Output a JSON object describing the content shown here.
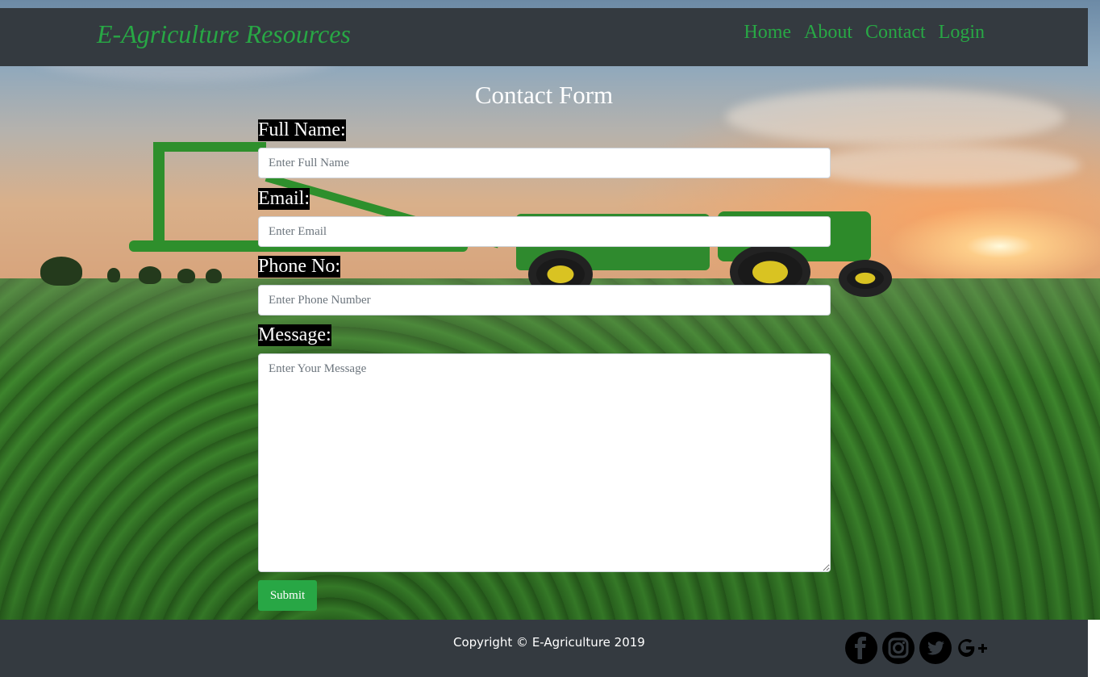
{
  "header": {
    "brand": "E-Agriculture Resources",
    "nav": [
      "Home",
      "About",
      "Contact",
      "Login"
    ]
  },
  "form": {
    "title": "Contact Form",
    "full_name_label": "Full Name:",
    "full_name_placeholder": "Enter Full Name",
    "email_label": "Email:",
    "email_placeholder": "Enter Email",
    "phone_label": "Phone No:",
    "phone_placeholder": "Enter Phone Number",
    "message_label": "Message:",
    "message_placeholder": "Enter Your Message",
    "submit_label": "Submit"
  },
  "footer": {
    "copyright": "Copyright © E-Agriculture 2019",
    "social_icons": [
      "facebook-icon",
      "instagram-icon",
      "twitter-icon",
      "google-plus-icon"
    ]
  },
  "colors": {
    "accent": "#28a745",
    "bar": "#343a40"
  }
}
